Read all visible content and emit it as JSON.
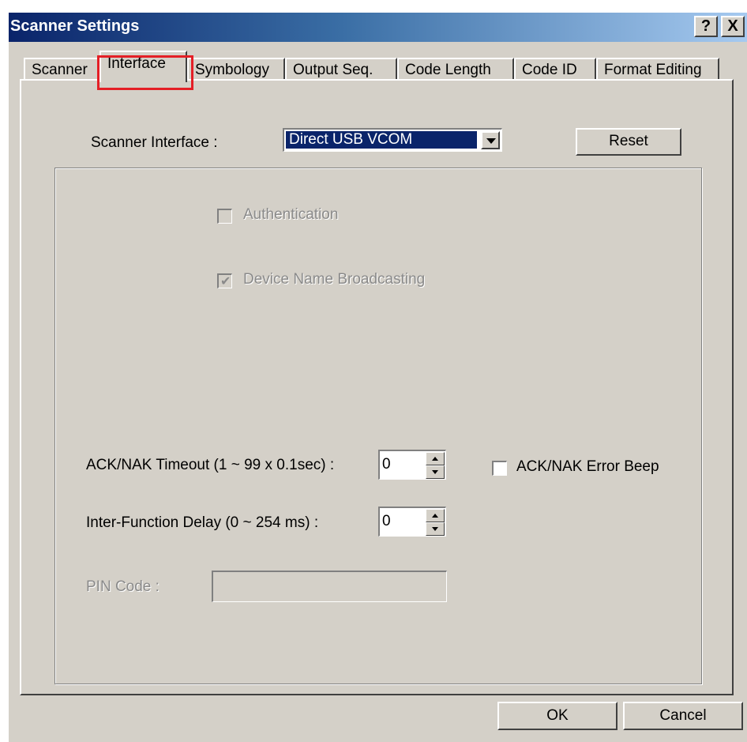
{
  "window": {
    "title": "Scanner Settings",
    "help_label": "?",
    "close_label": "X"
  },
  "tabs": [
    {
      "label": "Scanner"
    },
    {
      "label": "Interface"
    },
    {
      "label": "Symbology"
    },
    {
      "label": "Output Seq."
    },
    {
      "label": "Code Length"
    },
    {
      "label": "Code ID"
    },
    {
      "label": "Format Editing"
    }
  ],
  "interface": {
    "scanner_interface_label": "Scanner Interface :",
    "scanner_interface_value": "Direct USB VCOM",
    "reset_label": "Reset",
    "authentication": {
      "label": "Authentication",
      "checked": false,
      "enabled": false
    },
    "device_name_broadcasting": {
      "label": "Device Name Broadcasting",
      "checked": true,
      "enabled": false
    },
    "ack_nak_timeout_label": "ACK/NAK Timeout (1 ~ 99 x 0.1sec) :",
    "ack_nak_timeout_value": "0",
    "ack_nak_error_beep": {
      "label": "ACK/NAK Error Beep",
      "checked": false
    },
    "inter_function_delay_label": "Inter-Function Delay (0 ~ 254 ms) :",
    "inter_function_delay_value": "0",
    "pin_code_label": "PIN Code :",
    "pin_code_value": ""
  },
  "footer": {
    "ok_label": "OK",
    "cancel_label": "Cancel"
  },
  "colors": {
    "dialog_bg": "#d4d0c8",
    "title_gradient_start": "#0a246a",
    "selection_bg": "#0a246a",
    "highlight_box": "#e41f26"
  }
}
